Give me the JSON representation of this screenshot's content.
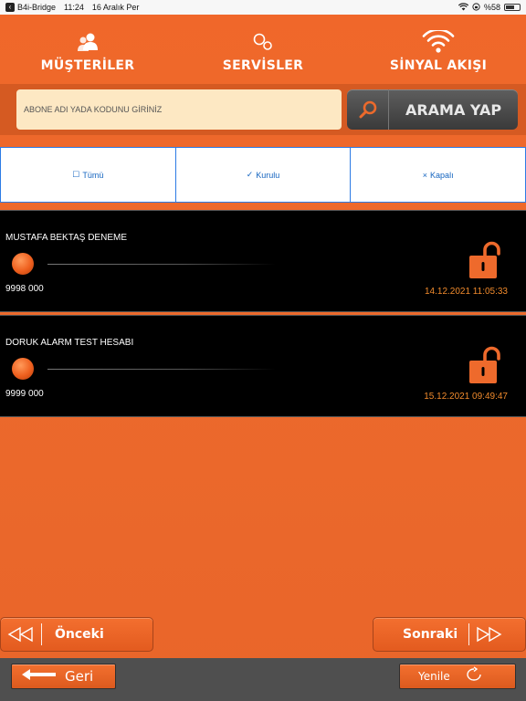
{
  "status_bar": {
    "app_back": "B4i-Bridge",
    "time": "11:24",
    "date": "16 Aralık Per",
    "battery": "%58"
  },
  "nav": {
    "customers": "MÜŞTERİLER",
    "services": "SERVİSLER",
    "signal_flow": "SİNYAL AKIŞI"
  },
  "search": {
    "placeholder": "ABONE ADI YADA KODUNU GİRİNİZ",
    "button": "ARAMA YAP"
  },
  "filters": {
    "all": "Tümü",
    "installed": "Kurulu",
    "closed": "Kapalı"
  },
  "accounts": [
    {
      "name": "MUSTAFA BEKTAŞ DENEME",
      "code": "9998 000",
      "timestamp": "14.12.2021 11:05:33"
    },
    {
      "name": "DORUK ALARM TEST HESABI",
      "code": "9999 000",
      "timestamp": "15.12.2021 09:49:47"
    }
  ],
  "pager": {
    "prev": "Önceki",
    "next": "Sonraki"
  },
  "bottom": {
    "back": "Geri",
    "refresh": "Yenile"
  },
  "colors": {
    "accent": "#ec6a2c",
    "date_text": "#f08a2c",
    "filter_blue": "#1565c0",
    "search_bg": "#fde8c3"
  }
}
